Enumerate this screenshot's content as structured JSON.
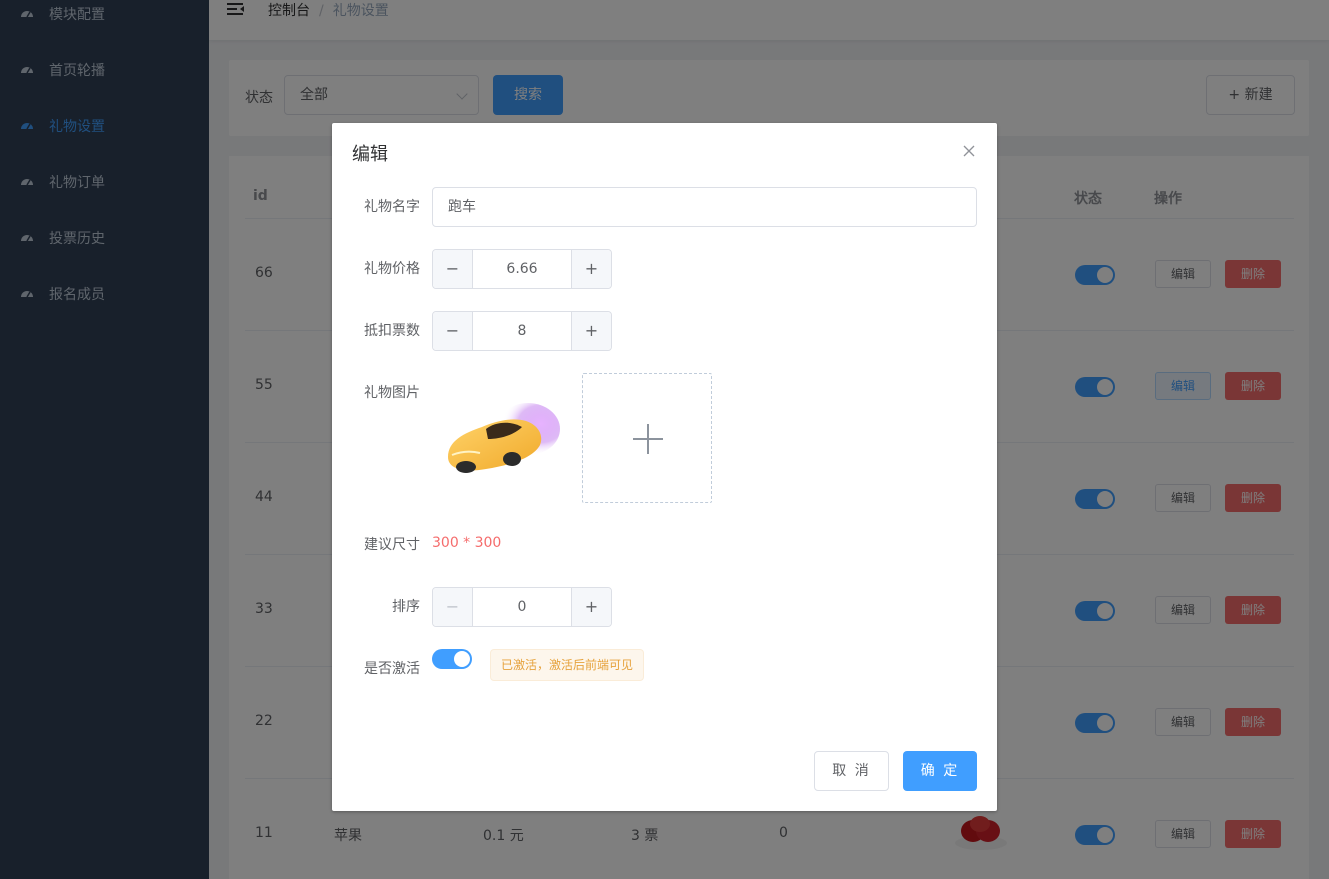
{
  "sidebar": {
    "items": [
      {
        "label": "模块配置",
        "icon": "dashboard-icon"
      },
      {
        "label": "首页轮播",
        "icon": "dashboard-icon"
      },
      {
        "label": "礼物设置",
        "icon": "dashboard-icon",
        "active": true
      },
      {
        "label": "礼物订单",
        "icon": "dashboard-icon"
      },
      {
        "label": "投票历史",
        "icon": "dashboard-icon"
      },
      {
        "label": "报名成员",
        "icon": "dashboard-icon"
      }
    ]
  },
  "header": {
    "breadcrumb_home": "控制台",
    "breadcrumb_sep": "/",
    "breadcrumb_current": "礼物设置"
  },
  "filter": {
    "status_label": "状态",
    "status_value": "全部",
    "search_label": "搜索",
    "new_label": "新建",
    "new_icon": "+"
  },
  "table": {
    "columns": {
      "id": "id",
      "status": "状态",
      "actions": "操作"
    },
    "edit_label": "编辑",
    "delete_label": "删除",
    "rows": [
      {
        "id": "66"
      },
      {
        "id": "55"
      },
      {
        "id": "44"
      },
      {
        "id": "33"
      },
      {
        "id": "22"
      },
      {
        "id": "11",
        "name": "苹果",
        "price": "0.1 元",
        "votes": "3 票",
        "sort": "0"
      }
    ]
  },
  "dialog": {
    "title": "编辑",
    "name_label": "礼物名字",
    "name_value": "跑车",
    "price_label": "礼物价格",
    "price_value": "6.66",
    "votes_label": "抵扣票数",
    "votes_value": "8",
    "image_label": "礼物图片",
    "size_label": "建议尺寸",
    "size_value": "300 * 300",
    "sort_label": "排序",
    "sort_value": "0",
    "active_label": "是否激活",
    "active_tag": "已激活，激活后前端可见",
    "cancel_label": "取 消",
    "confirm_label": "确 定",
    "minus": "−",
    "plus": "+"
  },
  "colors": {
    "sidebar_bg": "#304156",
    "primary": "#409eff",
    "danger": "#f56c6c",
    "warning": "#e6a23c"
  }
}
